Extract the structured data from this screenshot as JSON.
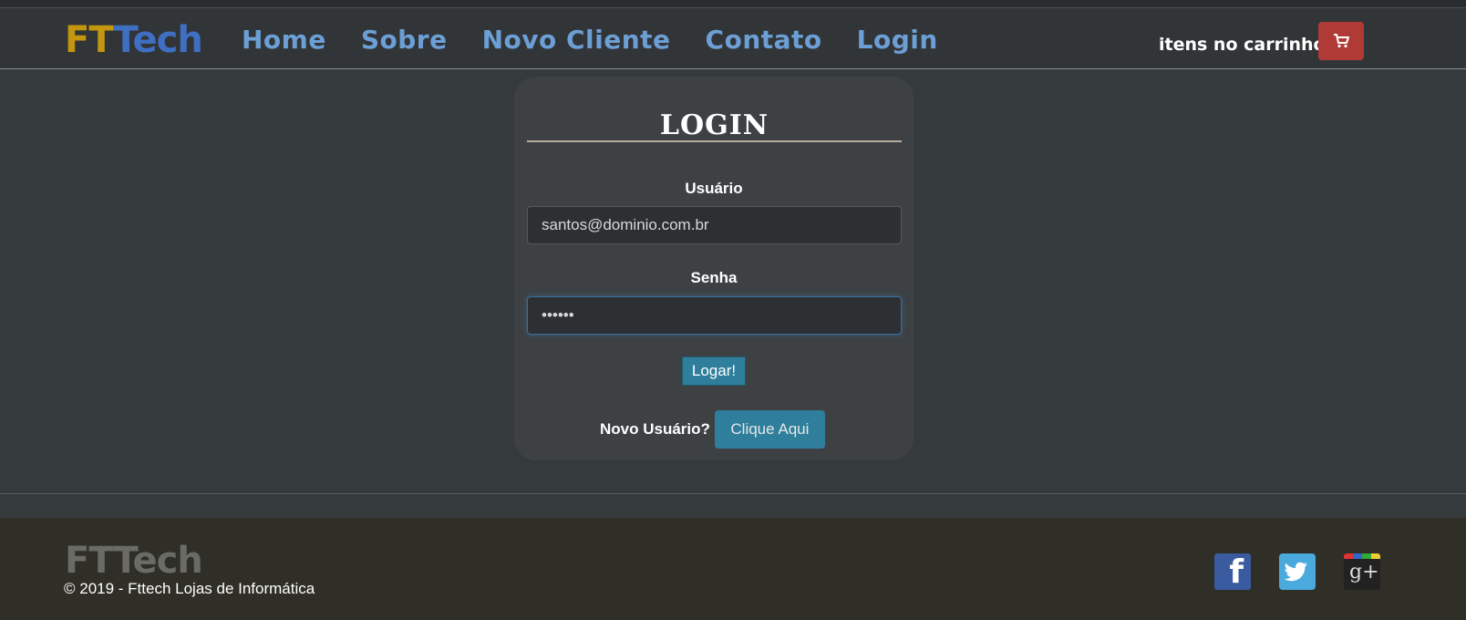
{
  "brand": {
    "logo_prefix": "FT",
    "logo_suffix": "Tech"
  },
  "nav": {
    "links": [
      {
        "label": "Home"
      },
      {
        "label": "Sobre"
      },
      {
        "label": "Novo Cliente"
      },
      {
        "label": "Contato"
      },
      {
        "label": "Login"
      }
    ]
  },
  "cart": {
    "label": "itens no carrinho",
    "icon": "shopping-cart-icon"
  },
  "login": {
    "title": "LOGIN",
    "user_label": "Usuário",
    "user_value": "santos@dominio.com.br",
    "password_label": "Senha",
    "password_value": "••••••",
    "submit_label": "Logar!",
    "new_user_label": "Novo Usuário?",
    "new_user_button": "Clique Aqui"
  },
  "footer": {
    "logo": "FTTech",
    "copyright": "© 2019 - Fttech Lojas de Informática",
    "social": [
      {
        "name": "facebook-icon",
        "glyph": "f"
      },
      {
        "name": "twitter-icon"
      },
      {
        "name": "google-plus-icon",
        "glyph": "g+"
      }
    ]
  },
  "colors": {
    "brand_gold": "#c4950f",
    "brand_blue": "#3e6fc2",
    "nav_link": "#6c9fd6",
    "cart_button": "#b03a36",
    "primary_button": "#2f7f9c",
    "background": "#353a3c",
    "footer_bg": "#2f2e27"
  }
}
